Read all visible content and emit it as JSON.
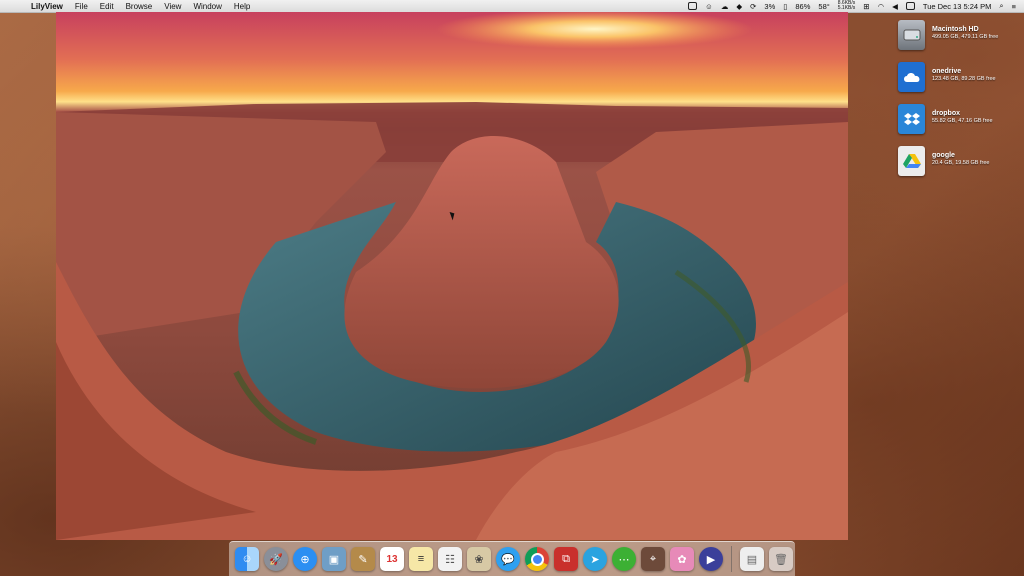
{
  "menubar": {
    "apple": "",
    "app_name": "LilyView",
    "menus": [
      "File",
      "Edit",
      "Browse",
      "View",
      "Window",
      "Help"
    ],
    "status": {
      "battery_percent": "3%",
      "temperature": "86%",
      "cpu_temp": "58°",
      "network_up": "8.6KB/s",
      "network_down": "5.1KB/s",
      "clock": "Tue Dec 13  5:24 PM"
    }
  },
  "drives": [
    {
      "name": "Macintosh HD",
      "size": "499.05 GB, 479.11 GB free",
      "color": "#8a8f96",
      "icon": "hard-drive-icon"
    },
    {
      "name": "onedrive",
      "size": "123.48 GB, 89.28 GB free",
      "color": "#1f6fd1",
      "icon": "cloud-icon"
    },
    {
      "name": "dropbox",
      "size": "55.82 GB, 47.16 GB free",
      "color": "#2a86d8",
      "icon": "dropbox-icon"
    },
    {
      "name": "google",
      "size": "20.4 GB, 19.58 GB free",
      "color": "#e9e9e9",
      "icon": "google-drive-icon"
    }
  ],
  "dock": {
    "apps": [
      "Finder",
      "Launchpad",
      "Safari",
      "Preview",
      "Notes",
      "Calendar",
      "TextEdit",
      "Reminders",
      "Photo Viewer",
      "Messages",
      "Chrome",
      "Parallels",
      "Telegram",
      "WeChat",
      "Screenshot",
      "Petals",
      "Video",
      "Downloads",
      "Trash"
    ]
  }
}
